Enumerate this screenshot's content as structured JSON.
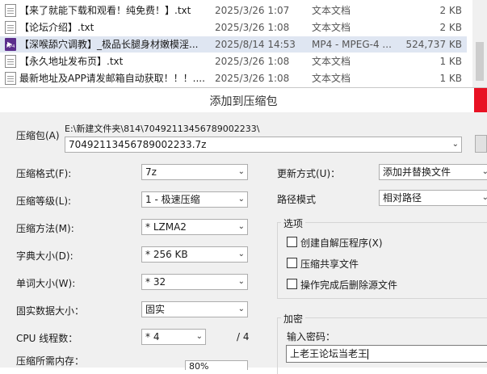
{
  "files": [
    {
      "name": "【来了就能下载和观看！纯免费！】.txt",
      "date": "2025/3/26 1:07",
      "type": "文本文档",
      "size": "2 KB",
      "icon": "txt-file-icon",
      "selected": false
    },
    {
      "name": "【论坛介绍】.txt",
      "date": "2025/3/26 1:08",
      "type": "文本文档",
      "size": "2 KB",
      "icon": "txt-file-icon",
      "selected": false
    },
    {
      "name": "【深喉舔穴调教】_极品长腿身材嫩模淫...",
      "date": "2025/8/14 14:53",
      "type": "MP4 - MPEG-4 ...",
      "size": "524,737 KB",
      "icon": "mp4-file-icon",
      "icon_text": "MP4",
      "selected": true
    },
    {
      "name": "【永久地址发布页】.txt",
      "date": "2025/3/26 1:08",
      "type": "文本文档",
      "size": "1 KB",
      "icon": "txt-file-icon",
      "selected": false
    },
    {
      "name": "最新地址及APP请发邮箱自动获取！！！....",
      "date": "2025/3/26 1:08",
      "type": "文本文档",
      "size": "1 KB",
      "icon": "txt-file-icon",
      "selected": false
    }
  ],
  "dialog": {
    "title": "添加到压缩包",
    "archive_label": "压缩包(A)",
    "archive_path": "E:\\新建文件夹\\814\\70492113456789002233\\",
    "archive_name": "70492113456789002233.7z",
    "format_label": "压缩格式(F):",
    "format_value": "7z",
    "level_label": "压缩等级(L):",
    "level_value": "1 - 极速压缩",
    "method_label": "压缩方法(M):",
    "method_value": "* LZMA2",
    "dict_label": "字典大小(D):",
    "dict_value": "* 256 KB",
    "word_label": "单词大小(W):",
    "word_value": "* 32",
    "solid_label": "固实数据大小：",
    "solid_value": "固实",
    "threads_label": "CPU 线程数：",
    "threads_value": "* 4",
    "threads_total": "/ 4",
    "memory_label": "压缩所需内存：",
    "memory_value": "80%",
    "update_label": "更新方式(U)：",
    "update_value": "添加并替换文件",
    "pathmode_label": "路径模式",
    "pathmode_value": "相对路径",
    "options_title": "选项",
    "opt_sfx": "创建自解压程序(X)",
    "opt_shared": "压缩共享文件",
    "opt_delete": "操作完成后删除源文件",
    "encrypt_title": "加密",
    "password_label": "输入密码：",
    "password_value": "上老王论坛当老王"
  }
}
